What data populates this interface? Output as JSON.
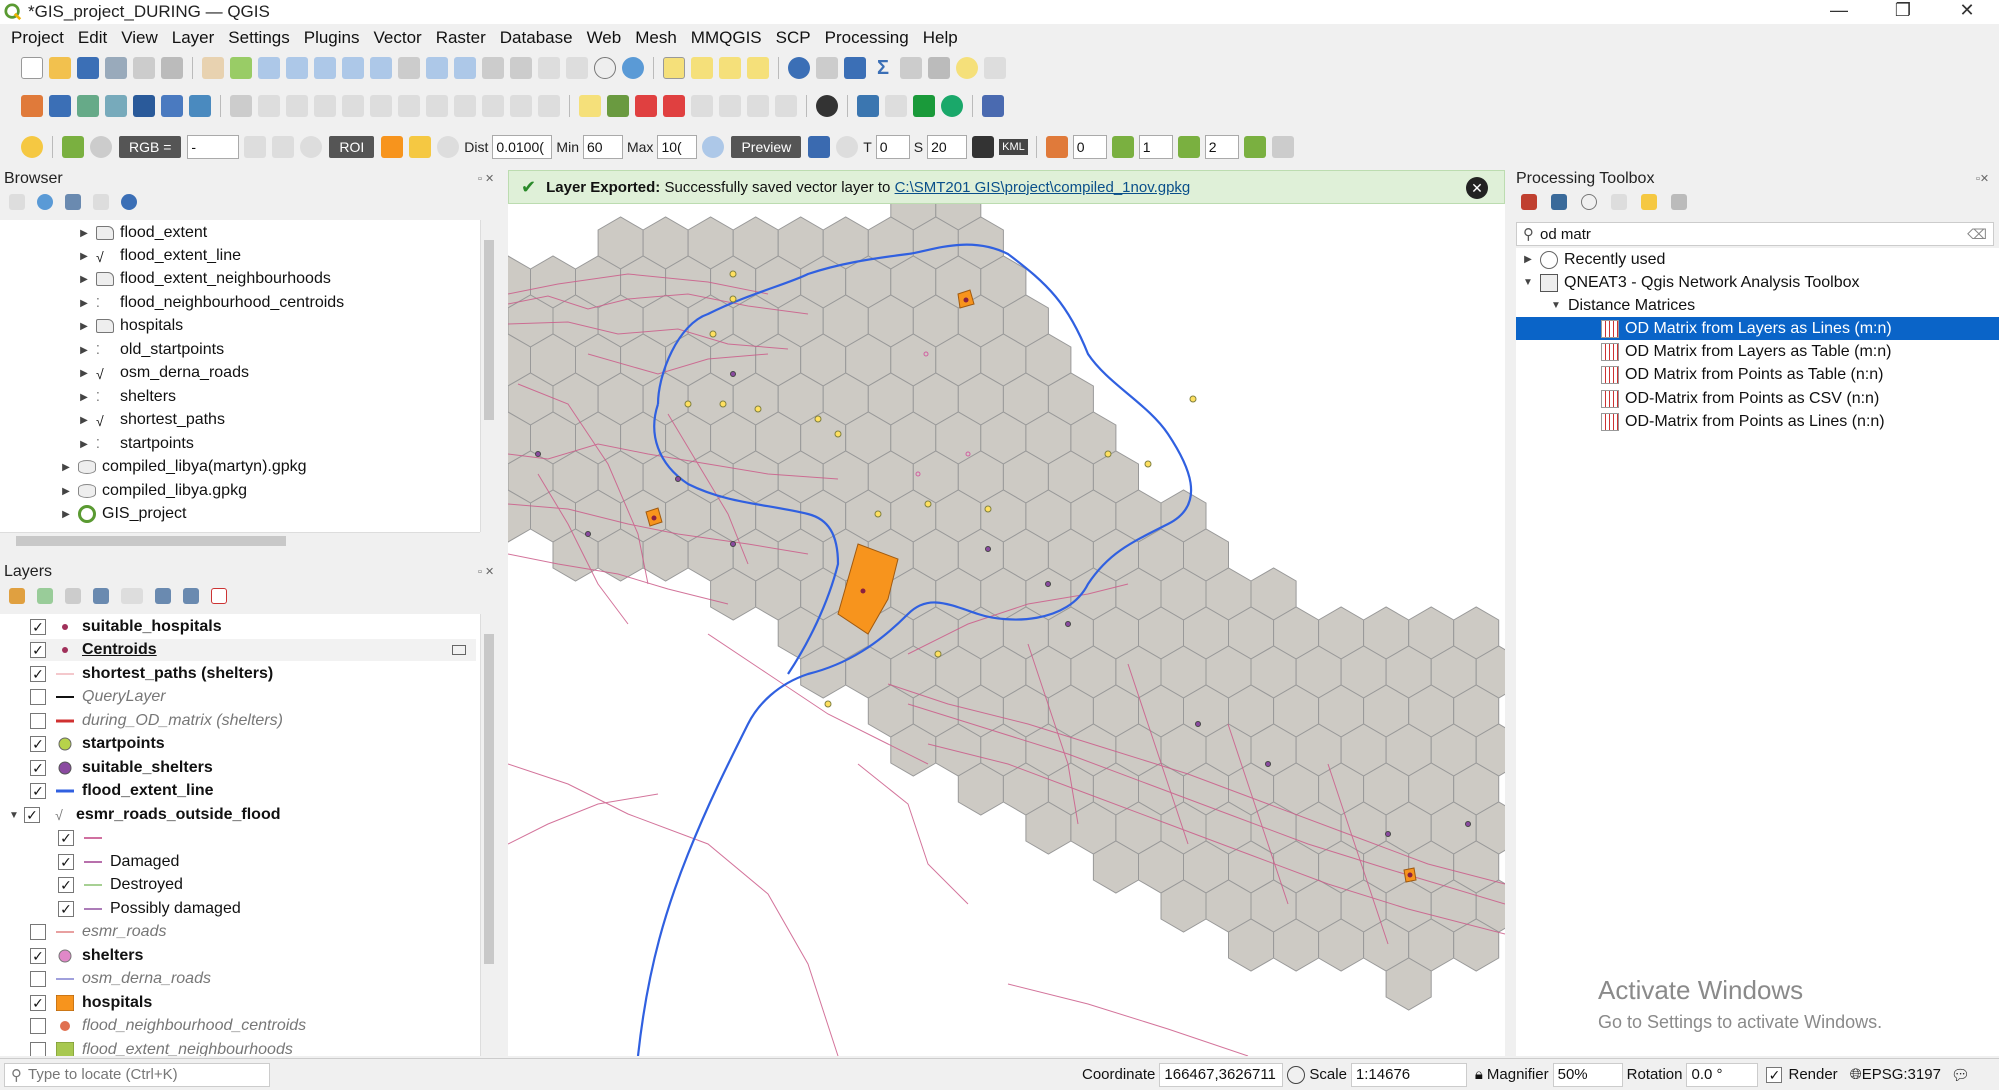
{
  "window": {
    "title": "*GIS_project_DURING — QGIS",
    "controls": [
      "—",
      "❐",
      "✕"
    ]
  },
  "menu": [
    "Project",
    "Edit",
    "View",
    "Layer",
    "Settings",
    "Plugins",
    "Vector",
    "Raster",
    "Database",
    "Web",
    "Mesh",
    "MMQGIS",
    "SCP",
    "Processing",
    "Help"
  ],
  "scp_toolbar": {
    "rgb_label": "RGB =",
    "rgb_value": "-",
    "roi_label": "ROI",
    "dist_label": "Dist",
    "dist_value": "0.0100(",
    "min_label": "Min",
    "min_value": "60",
    "max_label": "Max",
    "max_value": "10(",
    "preview_label": "Preview",
    "t_label": "T",
    "t_value": "0",
    "s_label": "S",
    "s_value": "20",
    "kml_label": "KML",
    "band1": "0",
    "band2": "1",
    "band3": "2"
  },
  "browser": {
    "title": "Browser",
    "items": [
      {
        "label": "flood_extent",
        "icon": "polygon-layer-icon"
      },
      {
        "label": "flood_extent_line",
        "icon": "line-layer-icon"
      },
      {
        "label": "flood_extent_neighbourhoods",
        "icon": "polygon-layer-icon"
      },
      {
        "label": "flood_neighbourhood_centroids",
        "icon": "point-layer-icon"
      },
      {
        "label": "hospitals",
        "icon": "polygon-layer-icon"
      },
      {
        "label": "old_startpoints",
        "icon": "point-layer-icon"
      },
      {
        "label": "osm_derna_roads",
        "icon": "line-layer-icon"
      },
      {
        "label": "shelters",
        "icon": "point-layer-icon"
      },
      {
        "label": "shortest_paths",
        "icon": "line-layer-icon"
      },
      {
        "label": "startpoints",
        "icon": "point-layer-icon"
      },
      {
        "label": "compiled_libya(martyn).gpkg",
        "icon": "geopackage-icon"
      },
      {
        "label": "compiled_libya.gpkg",
        "icon": "geopackage-icon"
      },
      {
        "label": "GIS_project",
        "icon": "qgis-project-icon"
      }
    ]
  },
  "layers": {
    "title": "Layers",
    "items": [
      {
        "label": "suitable_hospitals",
        "checked": true,
        "style": "bold",
        "symbol": "dot",
        "color": "#a0305a"
      },
      {
        "label": "Centroids",
        "checked": true,
        "style": "bold",
        "symbol": "dot",
        "color": "#a0305a"
      },
      {
        "label": "shortest_paths (shelters)",
        "checked": true,
        "style": "bold",
        "symbol": "line",
        "color": "#f4c8cc"
      },
      {
        "label": "QueryLayer",
        "checked": false,
        "style": "italic",
        "symbol": "line",
        "color": "#111111"
      },
      {
        "label": "during_OD_matrix (shelters)",
        "checked": false,
        "style": "italic",
        "symbol": "line",
        "color": "#d03030"
      },
      {
        "label": "startpoints",
        "checked": true,
        "style": "bold",
        "symbol": "circle",
        "color": "#b7d34a"
      },
      {
        "label": "suitable_shelters",
        "checked": true,
        "style": "bold",
        "symbol": "circle",
        "color": "#8a4aa0"
      },
      {
        "label": "flood_extent_line",
        "checked": true,
        "style": "bold",
        "symbol": "line",
        "color": "#3060e0"
      },
      {
        "label": "esmr_roads_outside_flood",
        "checked": true,
        "style": "bold",
        "symbol": "line-layer",
        "color": "#777777"
      },
      {
        "label": "",
        "checked": true,
        "style": "normal",
        "symbol": "line",
        "color": "#c04080",
        "sub": true
      },
      {
        "label": "Damaged",
        "checked": true,
        "style": "normal",
        "symbol": "line",
        "color": "#a04090",
        "sub": true
      },
      {
        "label": "Destroyed",
        "checked": true,
        "style": "normal",
        "symbol": "line",
        "color": "#8ac070",
        "sub": true
      },
      {
        "label": "Possibly damaged",
        "checked": true,
        "style": "normal",
        "symbol": "line",
        "color": "#9050a0",
        "sub": true
      },
      {
        "label": "esmr_roads",
        "checked": false,
        "style": "italic",
        "symbol": "line",
        "color": "#e08080"
      },
      {
        "label": "shelters",
        "checked": true,
        "style": "bold",
        "symbol": "circle",
        "color": "#e088c8"
      },
      {
        "label": "osm_derna_roads",
        "checked": false,
        "style": "italic",
        "symbol": "line",
        "color": "#8080d0"
      },
      {
        "label": "hospitals",
        "checked": true,
        "style": "bold",
        "symbol": "square",
        "color": "#f7941d"
      },
      {
        "label": "flood_neighbourhood_centroids",
        "checked": false,
        "style": "italic",
        "symbol": "circle",
        "color": "#e07050"
      },
      {
        "label": "flood_extent_neighbourhoods",
        "checked": false,
        "style": "italic",
        "symbol": "square",
        "color": "#a8c850"
      }
    ]
  },
  "message": {
    "bold": "Layer Exported:",
    "text": "Successfully saved vector layer to",
    "link": "C:\\SMT201 GIS\\project\\compiled_1nov.gpkg"
  },
  "toolbox": {
    "title": "Processing Toolbox",
    "search_value": "od matr",
    "groups": [
      {
        "label": "Recently used",
        "icon": "clock-icon"
      },
      {
        "label": "QNEAT3 - Qgis Network Analysis Toolbox",
        "icon": "qneat3-icon"
      }
    ],
    "subgroup": "Distance Matrices",
    "algorithms": [
      {
        "label": "OD Matrix from Layers as Lines (m:n)",
        "selected": true
      },
      {
        "label": "OD Matrix from Layers as Table (m:n)",
        "selected": false
      },
      {
        "label": "OD Matrix from Points as Table (n:n)",
        "selected": false
      },
      {
        "label": "OD-Matrix from Points as CSV (n:n)",
        "selected": false
      },
      {
        "label": "OD-Matrix from Points as Lines (n:n)",
        "selected": false
      }
    ]
  },
  "watermark": {
    "line1": "Activate Windows",
    "line2": "Go to Settings to activate Windows."
  },
  "status": {
    "locator_placeholder": "Type to locate (Ctrl+K)",
    "coordinate_label": "Coordinate",
    "coordinate_value": "166467,3626711",
    "scale_label": "Scale",
    "scale_value": "1:14676",
    "magnifier_label": "Magnifier",
    "magnifier_value": "50%",
    "rotation_label": "Rotation",
    "rotation_value": "0.0 °",
    "render_label": "Render",
    "crs_label": "EPSG:3197"
  },
  "colors": {
    "hex_fill": "#cdcac4",
    "hex_stroke": "#999999",
    "roads": "#cc5c8a",
    "flood_line": "#3060e0",
    "hospital": "#f7941d",
    "selection": "#0a64c8"
  }
}
